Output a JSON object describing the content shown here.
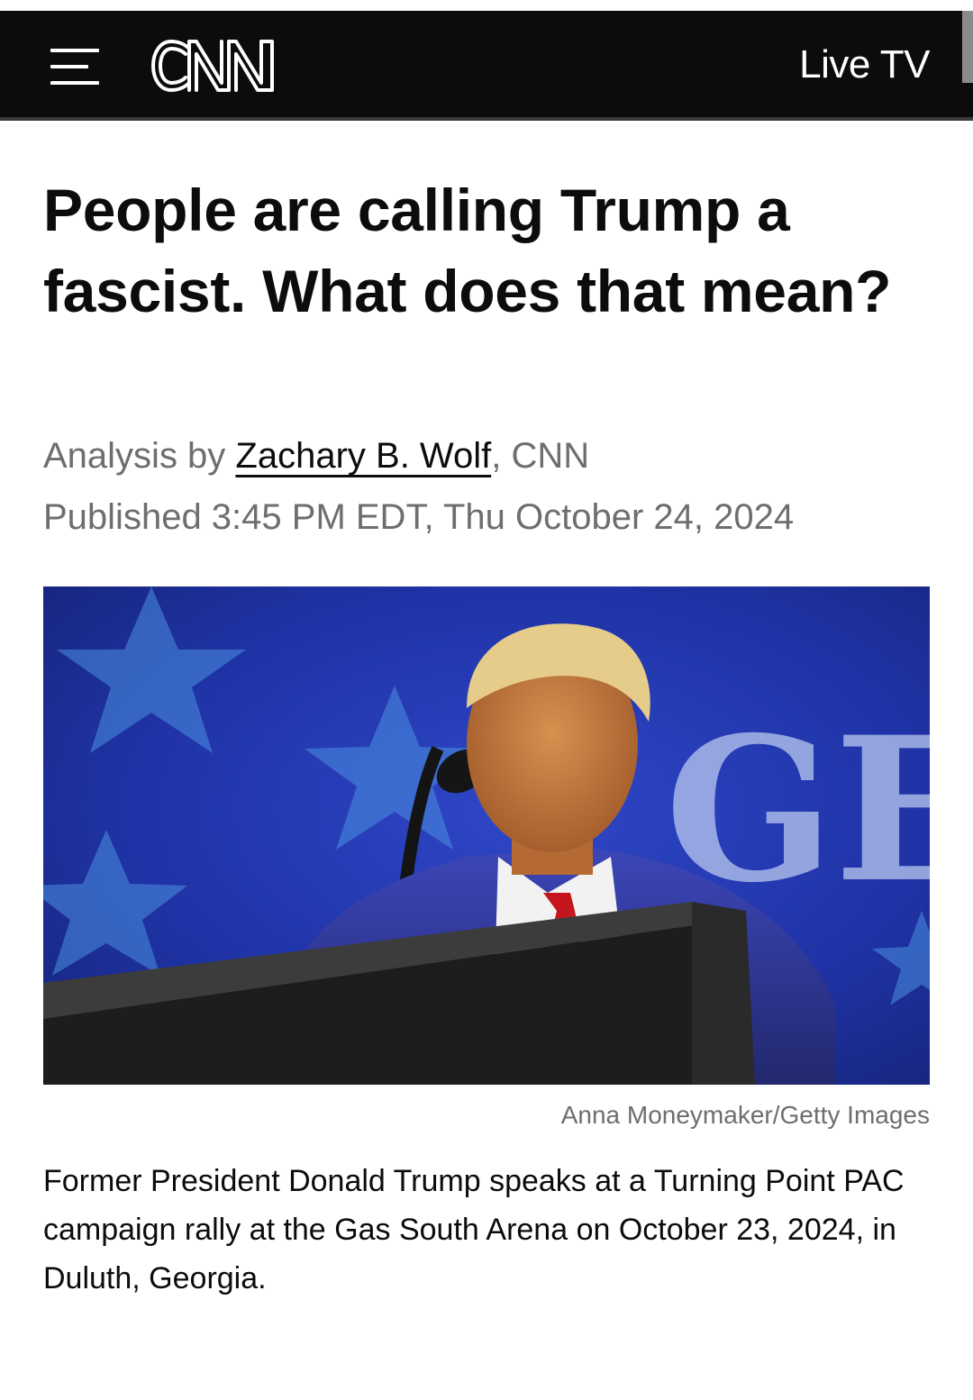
{
  "header": {
    "logo_text": "CNN",
    "live_tv_label": "Live TV",
    "background_color": "#0c0c0c"
  },
  "article": {
    "headline": "People are calling Trump a fascist. What does that mean?",
    "byline_prefix": "Analysis by ",
    "author": "Zachary B. Wolf",
    "byline_suffix": ", CNN",
    "published": "Published 3:45 PM EDT, Thu October 24, 2024"
  },
  "image": {
    "description_icon": "photo",
    "credit": "Anna Moneymaker/Getty Images",
    "caption": "Former President Donald Trump speaks at a Turning Point PAC campaign rally at the Gas South Arena on October 23, 2024, in Duluth, Georgia.",
    "backdrop_text": "GE"
  },
  "icons": {
    "menu": "hamburger-menu-icon",
    "logo": "cnn-logo"
  }
}
